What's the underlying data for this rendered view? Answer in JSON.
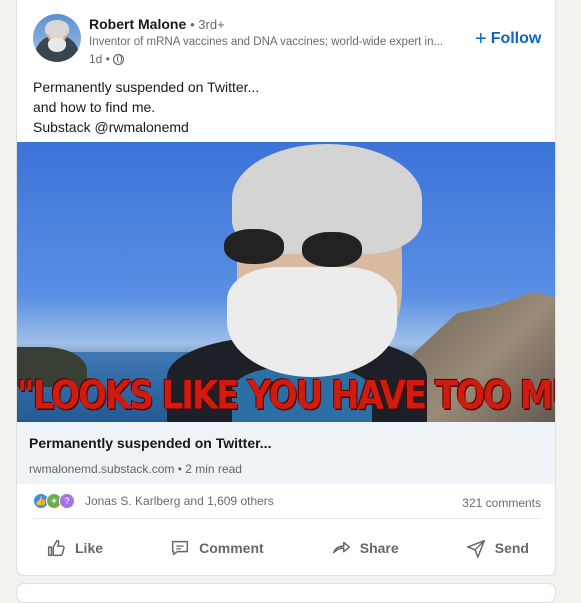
{
  "author": {
    "name": "Robert Malone",
    "degree": "• 3rd+",
    "headline": "Inventor of mRNA vaccines and DNA vaccines; world-wide expert in...",
    "time": "1d •"
  },
  "follow_label": "Follow",
  "post": {
    "lines": [
      "Permanently suspended on Twitter...",
      "and how to find me.",
      "Substack @rwmalonemd"
    ]
  },
  "image": {
    "caption": "\"LOOKS LIKE YOU HAVE TOO MUCH"
  },
  "link": {
    "title": "Permanently suspended on Twitter...",
    "meta": "rwmalonemd.substack.com • 2 min read"
  },
  "social": {
    "reactions_text": "Jonas S. Karlberg and 1,609 others",
    "comments": "321 comments"
  },
  "actions": {
    "like": "Like",
    "comment": "Comment",
    "repost": "Share",
    "send": "Send"
  },
  "colors": {
    "accent": "#0a66c2",
    "caption": "#d01b0f"
  }
}
